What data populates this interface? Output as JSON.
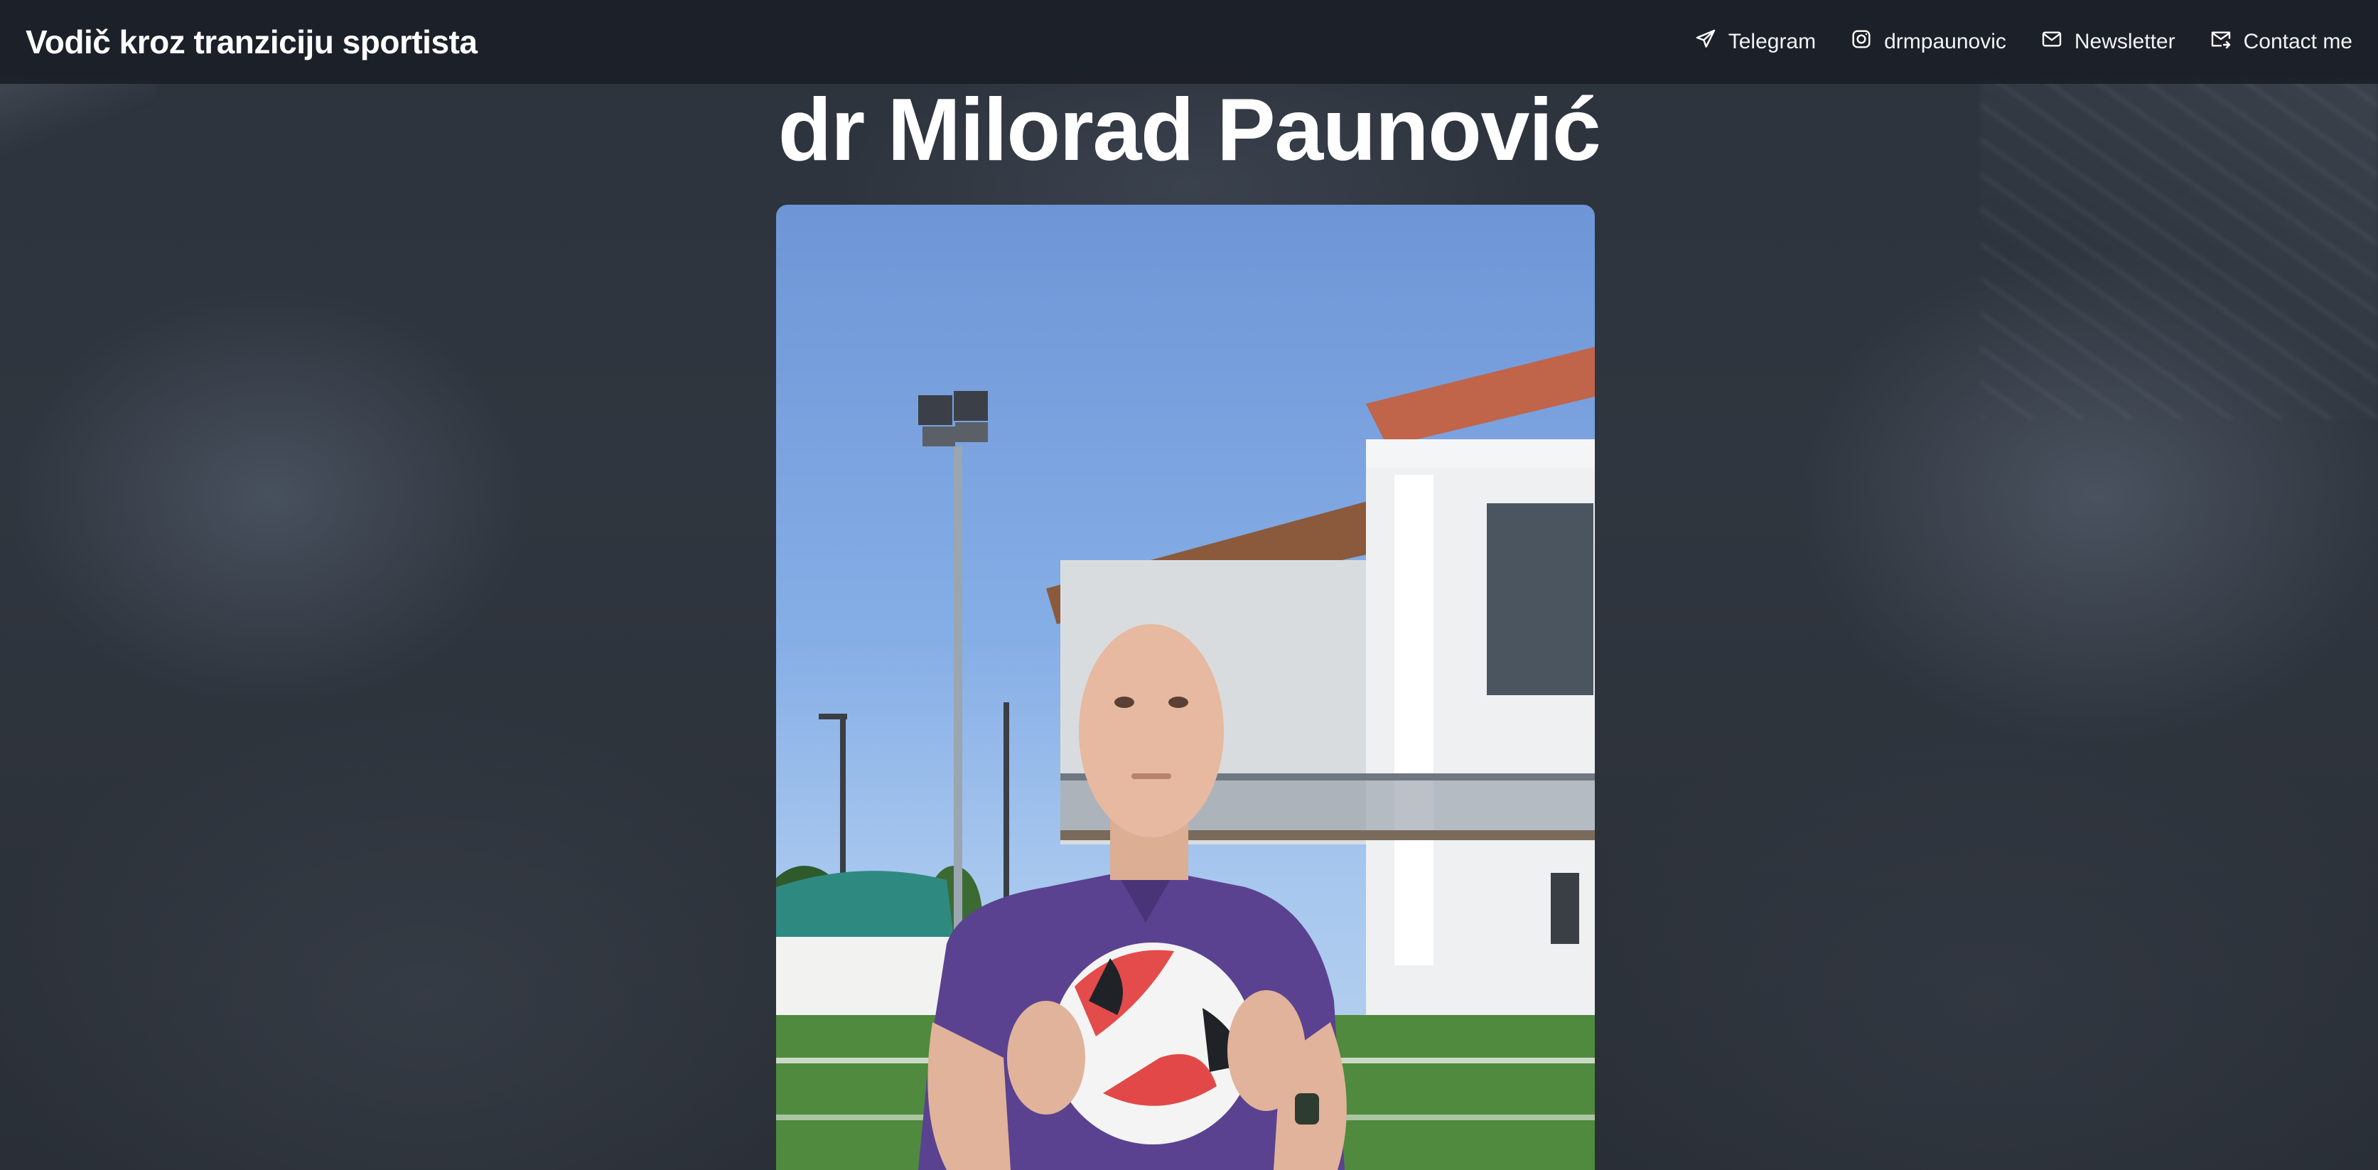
{
  "header": {
    "site_title": "Vodič kroz tranziciju sportista",
    "nav": [
      {
        "label": "Telegram",
        "icon": "telegram-send-icon"
      },
      {
        "label": "drmpaunovic",
        "icon": "instagram-icon"
      },
      {
        "label": "Newsletter",
        "icon": "mail-icon"
      },
      {
        "label": "Contact me",
        "icon": "contact-mail-icon"
      }
    ]
  },
  "main": {
    "title": "dr Milorad Paunović"
  }
}
